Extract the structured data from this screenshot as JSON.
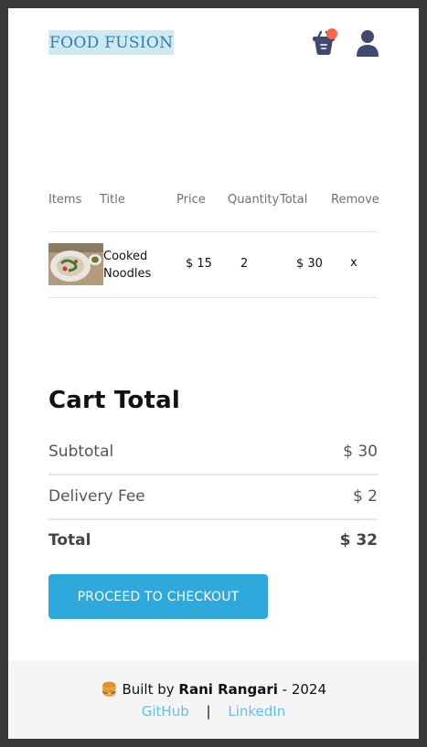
{
  "header": {
    "logo": "FOOD FUSION",
    "basket_icon": "basket-icon",
    "user_icon": "user-icon",
    "accent_dot_color": "#ff6447"
  },
  "table": {
    "headers": [
      "Items",
      "Title",
      "Price",
      "Quantity",
      "Total",
      "Remove"
    ],
    "rows": [
      {
        "image": "noodles-photo",
        "title_line1": "Cooked",
        "title_line2": "Noodles",
        "price": "$ 15",
        "quantity": "2",
        "total": "$ 30",
        "remove": "x"
      }
    ]
  },
  "cart_total": {
    "title": "Cart Total",
    "subtotal_label": "Subtotal",
    "subtotal_value": "$ 30",
    "delivery_label": "Delivery Fee",
    "delivery_value": "$ 2",
    "total_label": "Total",
    "total_value": "$ 32",
    "checkout_button": "PROCEED TO CHECKOUT",
    "button_color": "#2fa8dc"
  },
  "footer": {
    "emoji": "🍔",
    "built_by": "Built by",
    "author": "Rani Rangari",
    "year_text": "- 2024",
    "github": "GitHub",
    "separator": "|",
    "linkedin": "LinkedIn",
    "link_color": "#5cc2ea"
  }
}
